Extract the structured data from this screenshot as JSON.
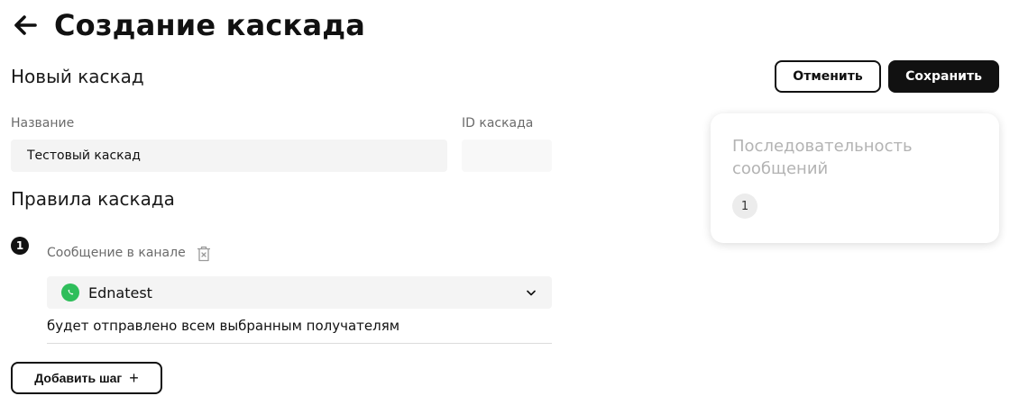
{
  "header": {
    "title": "Создание каскада",
    "back_icon": "arrow-left-icon"
  },
  "subtitle": "Новый каскад",
  "actions": {
    "cancel_label": "Отменить",
    "save_label": "Сохранить"
  },
  "form": {
    "name": {
      "label": "Название",
      "value": "Тестовый каскад"
    },
    "cascade_id": {
      "label": "ID каскада",
      "value": ""
    }
  },
  "rules": {
    "title": "Правила каскада",
    "steps": [
      {
        "number": "1",
        "label": "Сообщение в канале",
        "delete_icon": "trash-icon",
        "channel": {
          "icon": "whatsapp-icon",
          "value": "Ednatest"
        },
        "description": "будет отправлено всем выбранным получателям"
      }
    ],
    "add_step_label": "Добавить шаг",
    "add_step_icon": "+"
  },
  "sequence": {
    "title": "Последовательность сообщений",
    "items": [
      "1"
    ]
  },
  "colors": {
    "primary": "#111111",
    "whatsapp": "#2fbe5b",
    "muted_text": "#6b6b6b",
    "input_bg": "#f4f4f4"
  }
}
